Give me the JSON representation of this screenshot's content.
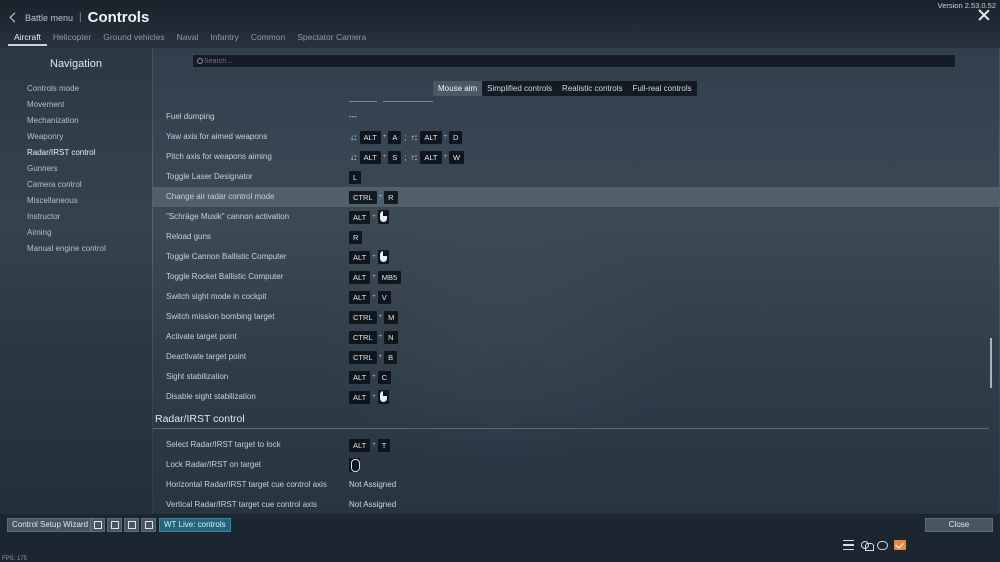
{
  "header": {
    "back_label": "Battle menu",
    "separator": "|",
    "title": "Controls",
    "version": "Version 2.53.0.52",
    "tabs": [
      "Aircraft",
      "Helicopter",
      "Ground vehicles",
      "Naval",
      "Infantry",
      "Common",
      "Spectator Camera"
    ],
    "active_tab": "Aircraft"
  },
  "nav": {
    "title": "Navigation",
    "items": [
      "Controls mode",
      "Movement",
      "Mechanization",
      "Weaponry",
      "Radar/IRST control",
      "Gunners",
      "Camera control",
      "Miscellaneous",
      "Instructor",
      "Aiming",
      "Manual engine control"
    ],
    "active_item": "Radar/IRST control"
  },
  "search": {
    "placeholder": "Search...",
    "value": ""
  },
  "modes": [
    "Mouse aim",
    "Simplified controls",
    "Realistic controls",
    "Full-real controls"
  ],
  "active_mode": "Mouse aim",
  "plus_sign": "+",
  "semicolon": ";",
  "rows": [
    {
      "label": "Fuel dumping",
      "plain": "---"
    },
    {
      "label": "Yaw axis for aimed weapons",
      "axis1": "↓:",
      "k1": "ALT",
      "k2": "A",
      "axis2": "↑:",
      "k3": "ALT",
      "k4": "D"
    },
    {
      "label": "Pitch axis for weapons aiming",
      "axis1": "↓:",
      "k1": "ALT",
      "k2": "S",
      "axis2": "↑:",
      "k3": "ALT",
      "k4": "W"
    },
    {
      "label": "Toggle Laser Designator",
      "k1": "L"
    },
    {
      "label": "Change air radar control mode",
      "k1": "CTRL",
      "k2": "R"
    },
    {
      "label": "\"Schräge Musik\" cannon activation",
      "k1": "ALT",
      "mouse": "right"
    },
    {
      "label": "Reload guns",
      "k1": "R"
    },
    {
      "label": "Toggle Cannon Ballistic Computer",
      "k1": "ALT",
      "mouse": "right"
    },
    {
      "label": "Toggle Rocket Ballistic Computer",
      "k1": "ALT",
      "k2": "MB5"
    },
    {
      "label": "Switch sight mode in cockpit",
      "k1": "ALT",
      "k2": "V"
    },
    {
      "label": "Switch mission bombing target",
      "k1": "CTRL",
      "k2": "M"
    },
    {
      "label": "Activate target point",
      "k1": "CTRL",
      "k2": "N"
    },
    {
      "label": "Deactivate target point",
      "k1": "CTRL",
      "k2": "B"
    },
    {
      "label": "Sight stabilization",
      "k1": "ALT",
      "k2": "C"
    },
    {
      "label": "Disable sight stabilization",
      "k1": "ALT",
      "mouse": "right"
    }
  ],
  "section": {
    "title": "Radar/IRST control"
  },
  "rows2": [
    {
      "label": "Select Radar/IRST target to lock",
      "k1": "ALT",
      "k2": "T"
    },
    {
      "label": "Lock Radar/IRST on target"
    },
    {
      "label": "Horizontal Radar/IRST target cue control axis",
      "plain": "Not Assigned"
    },
    {
      "label": "Vertical Radar/IRST target cue control axis",
      "plain": "Not Assigned"
    }
  ],
  "footer": {
    "wizard": "Control Setup Wizard",
    "live": "WT Live: controls",
    "close": "Close"
  },
  "fps": "FPS: 175"
}
